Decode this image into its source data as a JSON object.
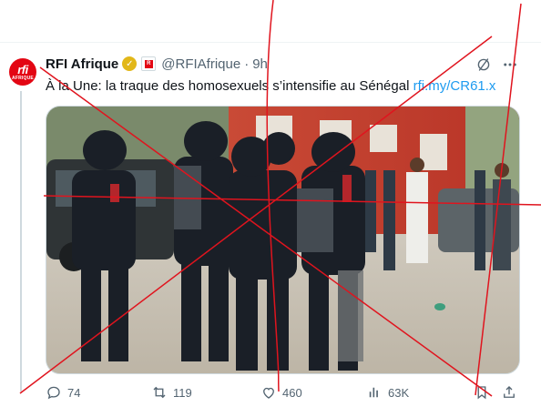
{
  "tweet": {
    "display_name": "RFI Afrique",
    "handle": "@RFIAfrique",
    "separator": "·",
    "time": "9h",
    "text_prefix": "À la Une: la traque des homosexuels s’intensifie au Sénégal",
    "link_text": "rfi.my/CR61.x",
    "avatar": {
      "logo_main": "rfi",
      "logo_sub": "AFRIQUE"
    },
    "icons": {
      "verified": "gold-verified-badge-icon",
      "affiliation": "rfi-affiliate-badge-icon",
      "grok": "grok-slash-circle-icon",
      "more": "more-horizontal-icon"
    }
  },
  "actions": {
    "replies": "74",
    "reposts": "119",
    "likes": "460",
    "views": "63K",
    "icons": [
      "reply-icon",
      "repost-icon",
      "like-icon",
      "views-icon",
      "bookmark-icon",
      "share-icon"
    ]
  },
  "colors": {
    "accent_link": "#1d9bf0",
    "text_primary": "#0f1419",
    "text_secondary": "#536471",
    "verified_gold": "#e2b719",
    "brand_red": "#e30613",
    "annotation_red": "#e0141e"
  }
}
